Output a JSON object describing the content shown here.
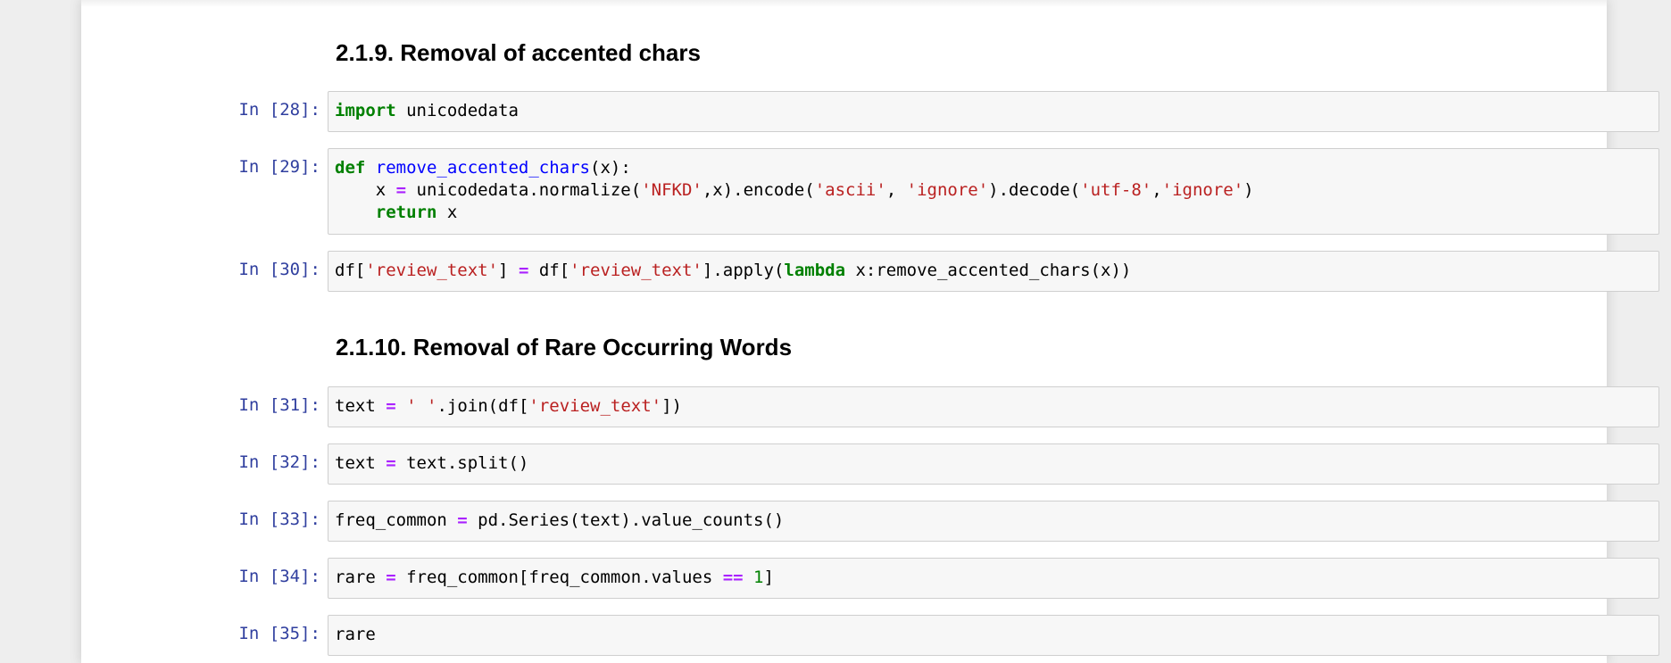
{
  "sections": [
    {
      "heading": "2.1.9. Removal of accented chars"
    },
    {
      "heading": "2.1.10. Removal of Rare Occurring Words"
    }
  ],
  "cells": [
    {
      "prompt": "In [28]:",
      "lines": [
        [
          {
            "t": "import",
            "c": "kw"
          },
          {
            "t": " unicodedata",
            "c": ""
          }
        ]
      ]
    },
    {
      "prompt": "In [29]:",
      "lines": [
        [
          {
            "t": "def",
            "c": "kw"
          },
          {
            "t": " ",
            "c": ""
          },
          {
            "t": "remove_accented_chars",
            "c": "fn"
          },
          {
            "t": "(x):",
            "c": ""
          }
        ],
        [
          {
            "t": "    x ",
            "c": ""
          },
          {
            "t": "=",
            "c": "op"
          },
          {
            "t": " unicodedata.normalize(",
            "c": ""
          },
          {
            "t": "'NFKD'",
            "c": "str"
          },
          {
            "t": ",x).encode(",
            "c": ""
          },
          {
            "t": "'ascii'",
            "c": "str"
          },
          {
            "t": ", ",
            "c": ""
          },
          {
            "t": "'ignore'",
            "c": "str"
          },
          {
            "t": ").decode(",
            "c": ""
          },
          {
            "t": "'utf-8'",
            "c": "str"
          },
          {
            "t": ",",
            "c": ""
          },
          {
            "t": "'ignore'",
            "c": "str"
          },
          {
            "t": ")",
            "c": ""
          }
        ],
        [
          {
            "t": "    ",
            "c": ""
          },
          {
            "t": "return",
            "c": "kw"
          },
          {
            "t": " x",
            "c": ""
          }
        ]
      ]
    },
    {
      "prompt": "In [30]:",
      "lines": [
        [
          {
            "t": "df[",
            "c": ""
          },
          {
            "t": "'review_text'",
            "c": "str"
          },
          {
            "t": "] ",
            "c": ""
          },
          {
            "t": "=",
            "c": "op"
          },
          {
            "t": " df[",
            "c": ""
          },
          {
            "t": "'review_text'",
            "c": "str"
          },
          {
            "t": "].apply(",
            "c": ""
          },
          {
            "t": "lambda",
            "c": "kw"
          },
          {
            "t": " x:remove_accented_chars(x))",
            "c": ""
          }
        ]
      ]
    },
    {
      "prompt": "In [31]:",
      "lines": [
        [
          {
            "t": "text ",
            "c": ""
          },
          {
            "t": "=",
            "c": "op"
          },
          {
            "t": " ",
            "c": ""
          },
          {
            "t": "' '",
            "c": "str"
          },
          {
            "t": ".join(df[",
            "c": ""
          },
          {
            "t": "'review_text'",
            "c": "str"
          },
          {
            "t": "])",
            "c": ""
          }
        ]
      ]
    },
    {
      "prompt": "In [32]:",
      "lines": [
        [
          {
            "t": "text ",
            "c": ""
          },
          {
            "t": "=",
            "c": "op"
          },
          {
            "t": " text.split()",
            "c": ""
          }
        ]
      ]
    },
    {
      "prompt": "In [33]:",
      "lines": [
        [
          {
            "t": "freq_common ",
            "c": ""
          },
          {
            "t": "=",
            "c": "op"
          },
          {
            "t": " pd.Series(text).value_counts()",
            "c": ""
          }
        ]
      ]
    },
    {
      "prompt": "In [34]:",
      "lines": [
        [
          {
            "t": "rare ",
            "c": ""
          },
          {
            "t": "=",
            "c": "op"
          },
          {
            "t": " freq_common[freq_common.values ",
            "c": ""
          },
          {
            "t": "==",
            "c": "op"
          },
          {
            "t": " ",
            "c": ""
          },
          {
            "t": "1",
            "c": "num"
          },
          {
            "t": "]",
            "c": ""
          }
        ]
      ]
    },
    {
      "prompt": "In [35]:",
      "lines": [
        [
          {
            "t": "rare",
            "c": ""
          }
        ]
      ]
    }
  ]
}
